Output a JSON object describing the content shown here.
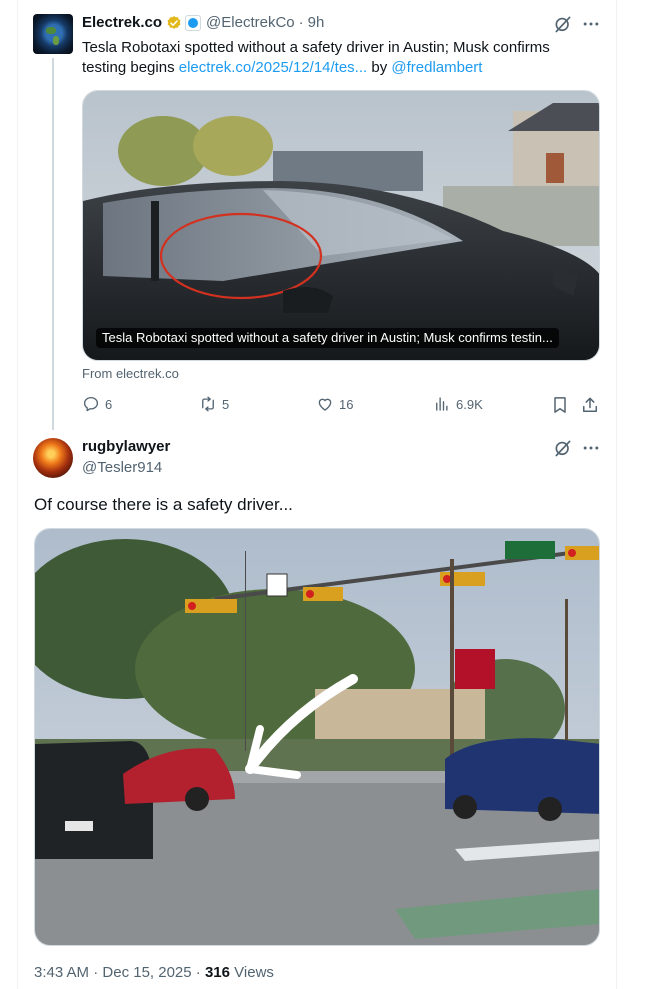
{
  "post1": {
    "author_name": "Electrek.co",
    "author_handle": "@ElectrekCo",
    "separator": "·",
    "time_ago": "9h",
    "text_prefix": "Tesla Robotaxi spotted without a safety driver in Austin; Musk confirms testing begins ",
    "link_text": "electrek.co/2025/12/14/tes...",
    "by_text": " by ",
    "mention": "@fredlambert",
    "card_caption": "Tesla Robotaxi spotted without a safety driver in Austin; Musk confirms testin...",
    "from_text": "From electrek.co",
    "actions": {
      "replies": "6",
      "reposts": "5",
      "likes": "16",
      "views": "6.9K"
    }
  },
  "post2": {
    "author_name": "rugbylawyer",
    "author_handle": "@Tesler914",
    "text": "Of course there is a safety driver...",
    "time": "3:43 AM",
    "date": "Dec 15, 2025",
    "separator": "·",
    "views_count": "316",
    "views_label": "Views"
  },
  "colors": {
    "accent": "#1d9bf0",
    "secondary_text": "#536471",
    "verified_gold": "#e2b719"
  },
  "icons": [
    "grok-icon",
    "more-icon",
    "reply-icon",
    "repost-icon",
    "like-icon",
    "views-icon",
    "bookmark-icon",
    "share-icon",
    "verified-badge-icon",
    "affiliate-badge-icon"
  ]
}
